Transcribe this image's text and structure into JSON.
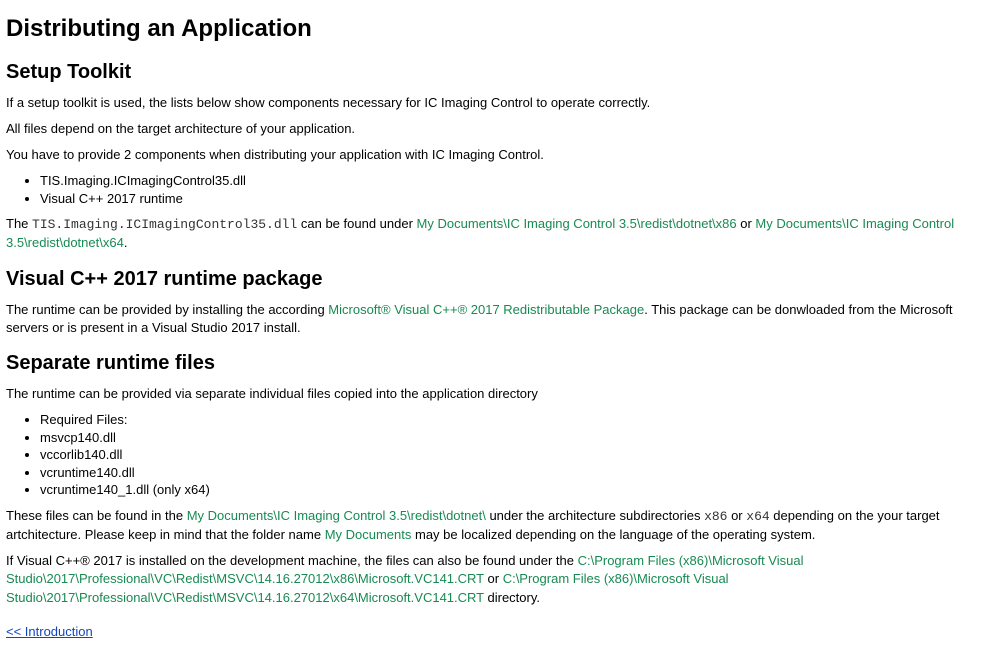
{
  "title": "Distributing an Application",
  "section1": {
    "heading": "Setup Toolkit",
    "p1": "If a setup toolkit is used, the lists below show components necessary for IC Imaging Control to operate correctly.",
    "p2": "All files depend on the target architecture of your application.",
    "p3": "You have to provide 2 components when distributing your application with IC Imaging Control.",
    "items": {
      "i0": "TIS.Imaging.ICImagingControl35.dll",
      "i1": "Visual C++ 2017 runtime"
    },
    "para4": {
      "t0": "The ",
      "code": "TIS.Imaging.ICImagingControl35.dll",
      "t1": " can be found under ",
      "link1": "My Documents\\IC Imaging Control 3.5\\redist\\dotnet\\x86",
      "t2": " or ",
      "link2": "My Documents\\IC Imaging Control 3.5\\redist\\dotnet\\x64",
      "t3": "."
    }
  },
  "section2": {
    "heading": "Visual C++ 2017 runtime package",
    "para": {
      "t0": "The runtime can be provided by installing the according ",
      "link": "Microsoft® Visual C++® 2017 Redistributable Package",
      "t1": ". This package can be donwloaded from the Microsoft servers or is present in a Visual Studio 2017 install."
    }
  },
  "section3": {
    "heading": "Separate runtime files",
    "p1": "The runtime can be provided via separate individual files copied into the application directory",
    "items": {
      "i0": "Required Files:",
      "i1": "msvcp140.dll",
      "i2": "vccorlib140.dll",
      "i3": "vcruntime140.dll",
      "i4": "vcruntime140_1.dll (only x64)"
    },
    "para2": {
      "t0": "These files can be found in the ",
      "link1": "My Documents\\IC Imaging Control 3.5\\redist\\dotnet\\",
      "t1": " under the architecture subdirectories ",
      "code1": "x86",
      "t2": " or ",
      "code2": "x64",
      "t3": " depending on the your target artchitecture. Please keep in mind that the folder name ",
      "link2": "My Documents",
      "t4": " may be localized depending on the language of the operating system."
    },
    "para3": {
      "t0": "If Visual C++® 2017 is installed on the development machine, the files can also be found under the ",
      "link1": "C:\\Program Files (x86)\\Microsoft Visual Studio\\2017\\Professional\\VC\\Redist\\MSVC\\14.16.27012\\x86\\Microsoft.VC141.CRT",
      "t1": " or ",
      "link2": "C:\\Program Files (x86)\\Microsoft Visual Studio\\2017\\Professional\\VC\\Redist\\MSVC\\14.16.27012\\x64\\Microsoft.VC141.CRT",
      "t2": " directory."
    }
  },
  "nav": {
    "prev": "<< Introduction"
  }
}
